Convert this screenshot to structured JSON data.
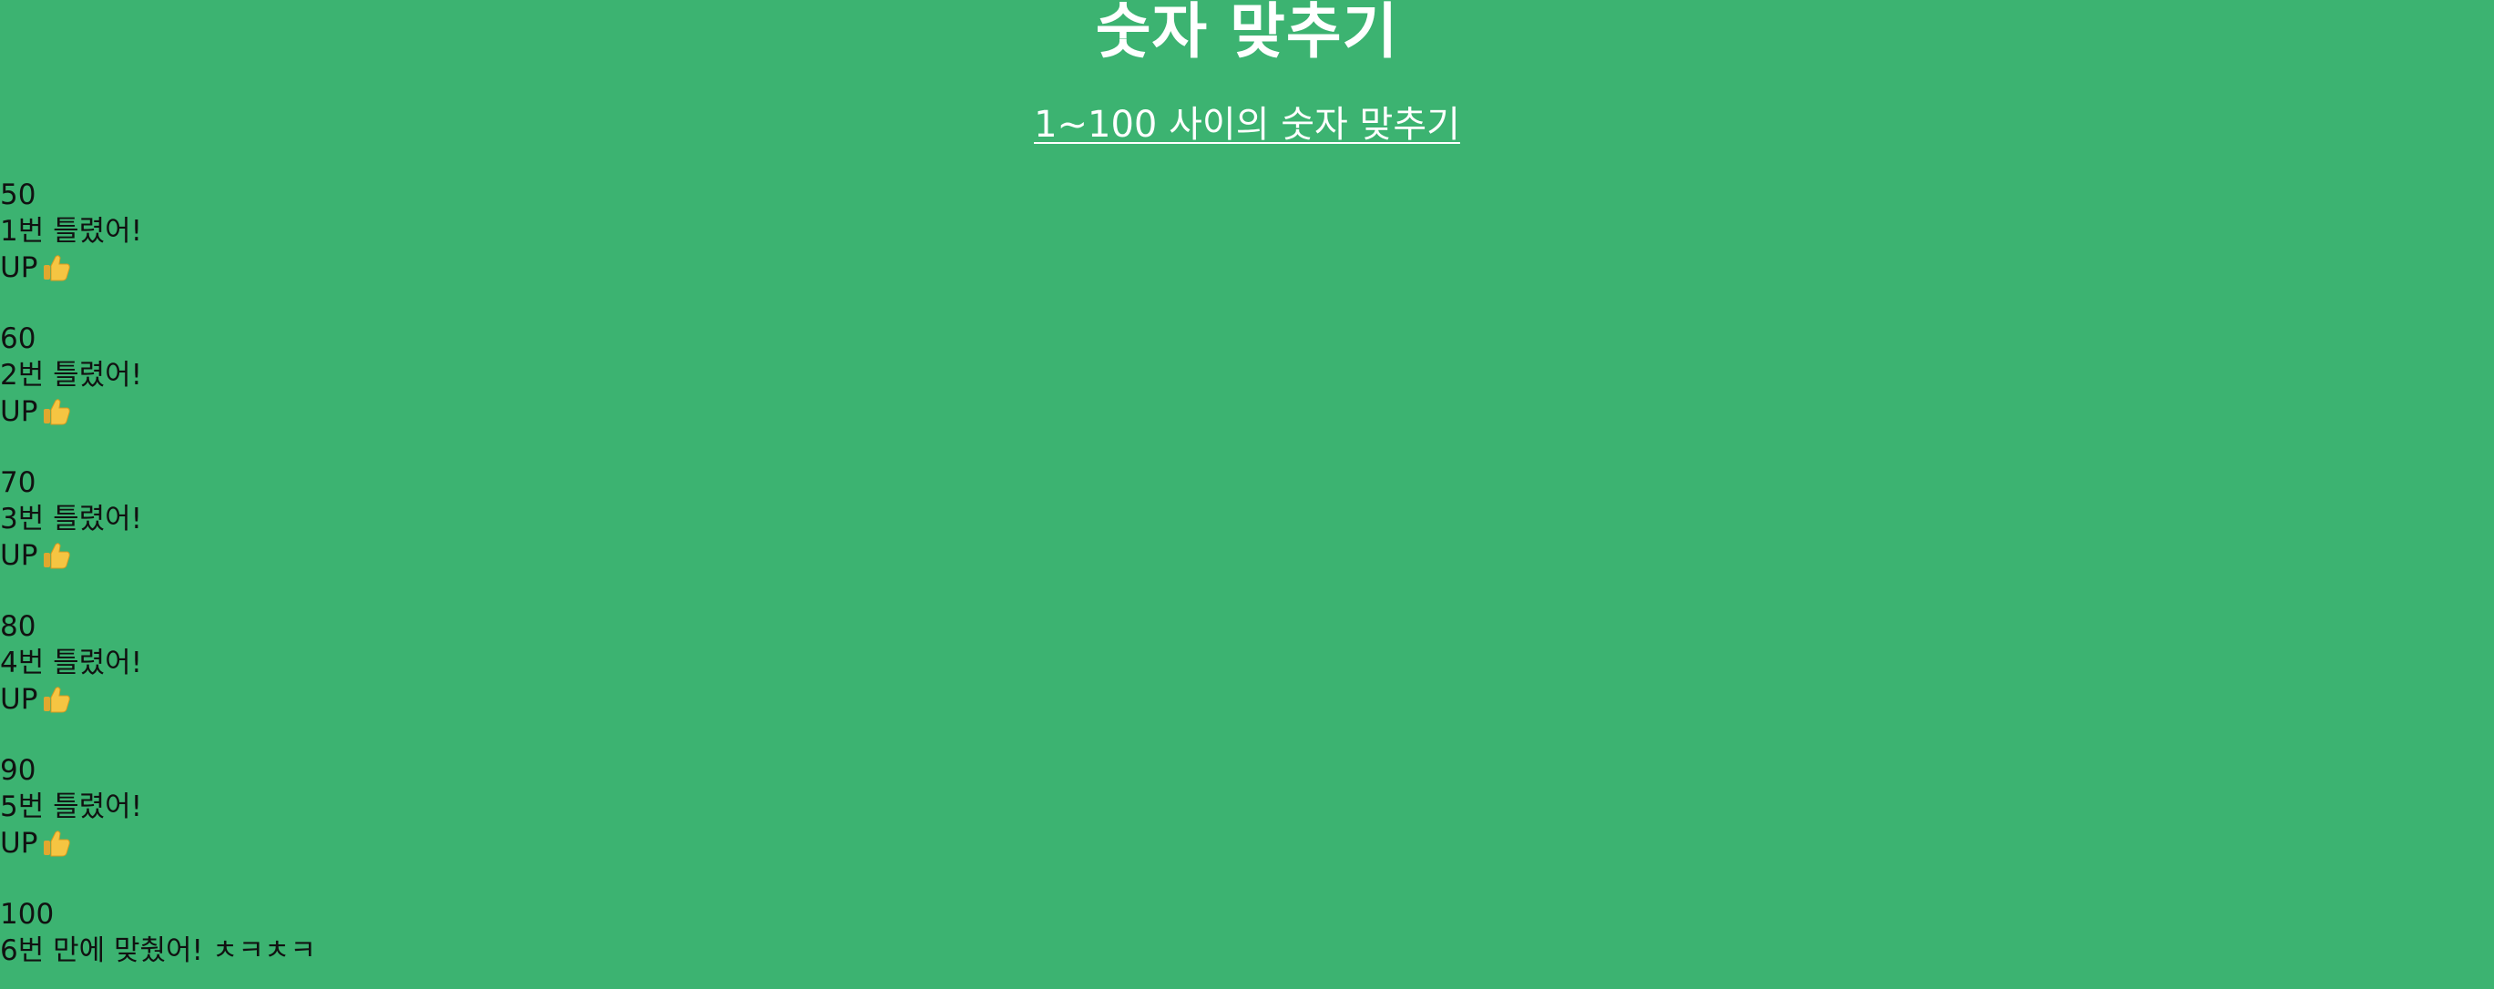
{
  "header": {
    "title": "숫자 맞추기",
    "subtitle_link": "1~100 사이의 숫자 맞추기"
  },
  "guesses": [
    {
      "number": "50",
      "result": "1번 틀렸어!",
      "hint": "UP",
      "hint_icon": "thumbs-up-icon"
    },
    {
      "number": "60",
      "result": "2번 틀렸어!",
      "hint": "UP",
      "hint_icon": "thumbs-up-icon"
    },
    {
      "number": "70",
      "result": "3번 틀렸어!",
      "hint": "UP",
      "hint_icon": "thumbs-up-icon"
    },
    {
      "number": "80",
      "result": "4번 틀렸어!",
      "hint": "UP",
      "hint_icon": "thumbs-up-icon"
    },
    {
      "number": "90",
      "result": "5번 틀렸어!",
      "hint": "UP",
      "hint_icon": "thumbs-up-icon"
    },
    {
      "number": "100",
      "result": "6번 만에 맞췄어! ㅊㅋㅊㅋ"
    }
  ],
  "colors": {
    "background": "#3cb371",
    "title": "#ffffff",
    "text": "#111111",
    "thumb": "#f5c542"
  }
}
